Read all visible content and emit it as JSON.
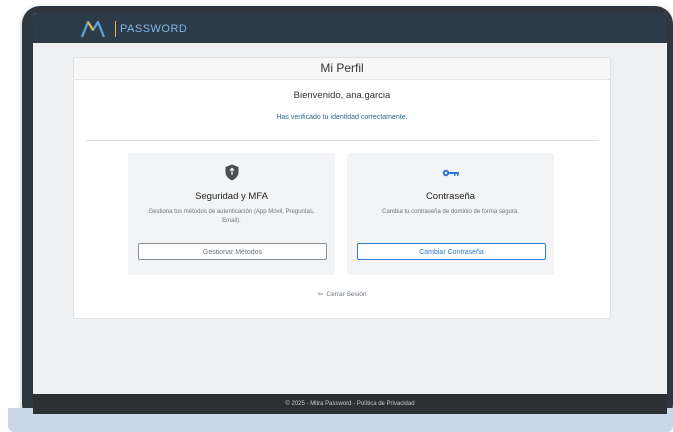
{
  "brand": {
    "name": "PASSWORD"
  },
  "card": {
    "title": "Mi Perfil",
    "welcome": "Bienvenido, ana.garcia",
    "verified": "Has verificado tu identidad correctamente."
  },
  "tiles": [
    {
      "icon": "shield-icon",
      "title": "Seguridad y MFA",
      "description": "Gestiona tus métodos de autenticación (App Móvil, Preguntas, Email).",
      "button": "Gestionar Métodos"
    },
    {
      "icon": "key-icon",
      "title": "Contraseña",
      "description": "Cambia tu contraseña de dominio de forma segura.",
      "button": "Cambiar Contraseña"
    }
  ],
  "logout": {
    "label": "Cerrar Sesión"
  },
  "footer": {
    "copyright": "© 2025 - Mitra Password",
    "separator": "-",
    "privacy": "Política de Privacidad"
  },
  "colors": {
    "nav": "#2d3b49",
    "accent_blue": "#2e7ad1",
    "brand_text": "#7fb7e6",
    "brand_divider": "#e7b545",
    "footer": "#2b3035"
  }
}
